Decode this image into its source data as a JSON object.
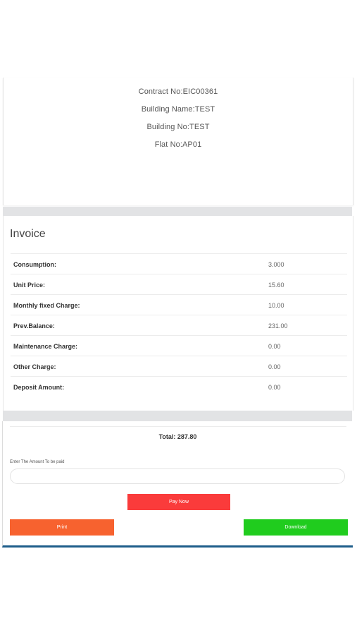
{
  "contract_info": {
    "contract_no": "Contract No:EIC00361",
    "building_name": "Building Name:TEST",
    "building_no": "Building No:TEST",
    "flat_no": "Flat No:AP01"
  },
  "invoice": {
    "title": "Invoice",
    "rows": [
      {
        "label": "Consumption:",
        "value": "3.000"
      },
      {
        "label": "Unit Price:",
        "value": "15.60"
      },
      {
        "label": "Monthly fixed Charge:",
        "value": "10.00"
      },
      {
        "label": "Prev.Balance:",
        "value": "231.00"
      },
      {
        "label": "Maintenance Charge:",
        "value": "0.00"
      },
      {
        "label": "Other Charge:",
        "value": "0.00"
      },
      {
        "label": "Deposit Amount:",
        "value": "0.00"
      }
    ]
  },
  "payment": {
    "total": "Total: 287.80",
    "amount_label": "Enter The Amount To be paid",
    "amount_value": "",
    "amount_placeholder": "",
    "pay_now_label": "Pay Now",
    "print_label": "Print",
    "download_label": "Download"
  },
  "colors": {
    "pay_now": "#fa3b3b",
    "print": "#f7622f",
    "download": "#20cc1e",
    "card_bottom_border": "#1e5d8a",
    "separator_band": "#e2e3e5"
  }
}
